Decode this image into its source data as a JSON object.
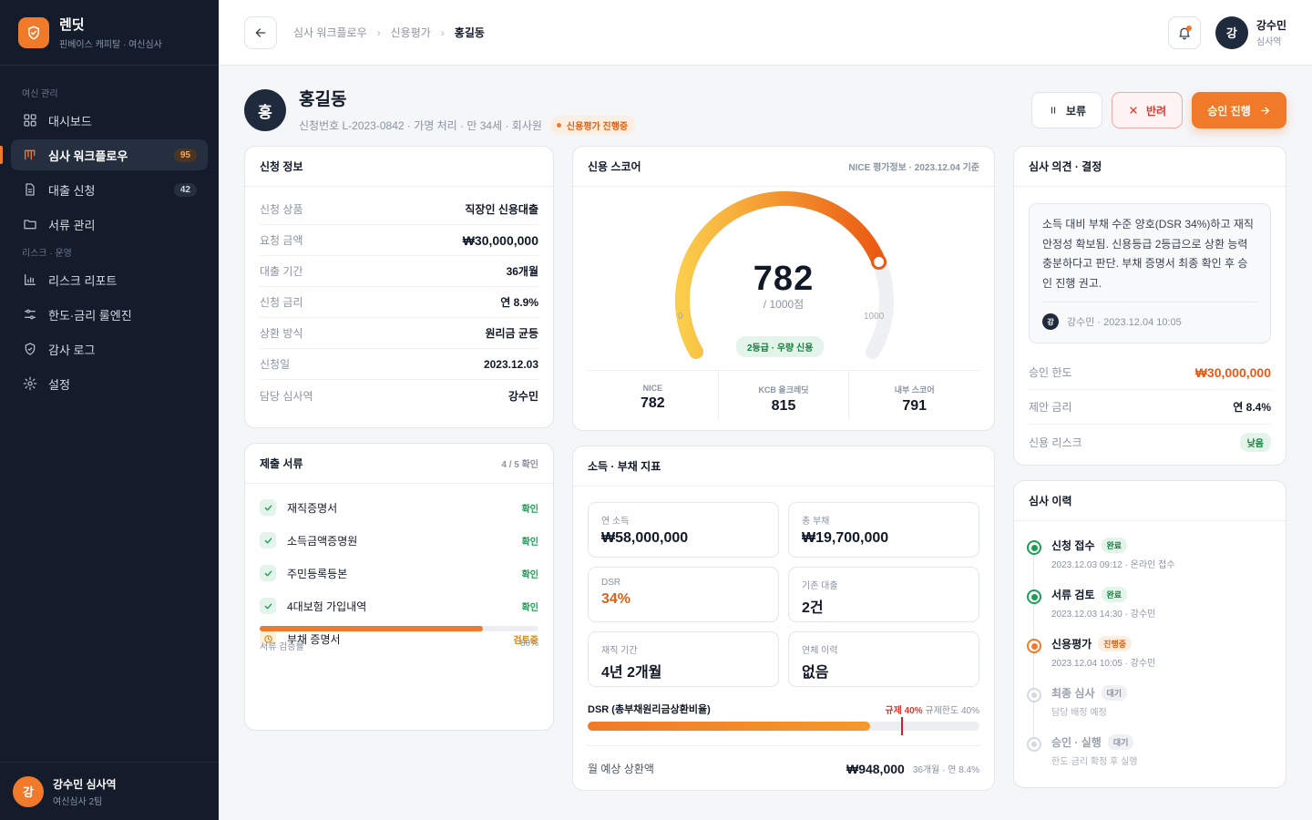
{
  "brand": {
    "name": "렌딧",
    "subtitle": "핀베이스 캐피탈 · 여신심사",
    "icon": "shield-check-icon"
  },
  "sidebar": {
    "section1": "여신 관리",
    "section2": "리스크 · 운영",
    "items": [
      {
        "label": "대시보드",
        "icon": "grid-icon"
      },
      {
        "label": "심사 워크플로우",
        "icon": "kanban-icon",
        "badge": "95",
        "active": true
      },
      {
        "label": "대출 신청",
        "icon": "document-icon",
        "badge": "42"
      },
      {
        "label": "서류 관리",
        "icon": "folder-icon"
      },
      {
        "label": "리스크 리포트",
        "icon": "bar-chart-icon"
      },
      {
        "label": "한도·금리 룰엔진",
        "icon": "sliders-icon"
      },
      {
        "label": "감사 로그",
        "icon": "shield-check-icon"
      },
      {
        "label": "설정",
        "icon": "gear-icon"
      }
    ],
    "user": {
      "initial": "강",
      "name": "강수민 심사역",
      "team": "여신심사 2팀"
    }
  },
  "topbar": {
    "breadcrumb": [
      "심사 워크플로우",
      "신용평가",
      "홍길동"
    ],
    "user": {
      "initial": "강",
      "name": "강수민",
      "role": "심사역"
    }
  },
  "applicant": {
    "initial": "홍",
    "name": "홍길동",
    "meta": "신청번호 L-2023-0842 · 가명 처리 · 만 34세 · 회사원",
    "status": "신용평가 진행중"
  },
  "actions": {
    "hold": "보류",
    "reject": "반려",
    "approve": "승인 진행"
  },
  "application_info": {
    "title": "신청 정보",
    "rows": [
      {
        "k": "신청 상품",
        "v": "직장인 신용대출"
      },
      {
        "k": "요청 금액",
        "v": "₩30,000,000"
      },
      {
        "k": "대출 기간",
        "v": "36개월"
      },
      {
        "k": "신청 금리",
        "v": "연 8.9%"
      },
      {
        "k": "상환 방식",
        "v": "원리금 균등"
      },
      {
        "k": "신청일",
        "v": "2023.12.03"
      },
      {
        "k": "담당 심사역",
        "v": "강수민"
      }
    ]
  },
  "documents": {
    "title": "제출 서류",
    "count": "4 / 5 확인",
    "items": [
      {
        "name": "재직증명서",
        "status": "확인",
        "done": true
      },
      {
        "name": "소득금액증명원",
        "status": "확인",
        "done": true
      },
      {
        "name": "주민등록등본",
        "status": "확인",
        "done": true
      },
      {
        "name": "4대보험 가입내역",
        "status": "확인",
        "done": true
      },
      {
        "name": "부채 증명서",
        "status": "검토중",
        "done": false
      }
    ],
    "progress_label": "서류 검증률",
    "progress_text": "80%",
    "progress": 0.8
  },
  "credit_score": {
    "title": "신용 스코어",
    "source": "NICE 평가정보 · 2023.12.04 기준",
    "score": "782",
    "max_label": "/ 1000점",
    "score_fraction": 0.782,
    "min_tick": "0",
    "max_tick": "1000",
    "grade": "2등급 · 우량 신용",
    "bureaus": [
      {
        "label": "NICE",
        "value": "782"
      },
      {
        "label": "KCB 올크레딧",
        "value": "815"
      },
      {
        "label": "내부 스코어",
        "value": "791"
      }
    ],
    "colors": {
      "start": "#fbcd4b",
      "end": "#ea5a12",
      "track": "#eef0f3"
    }
  },
  "income_debt": {
    "title": "소득 · 부채 지표",
    "metrics": [
      {
        "label": "연 소득",
        "value": "₩58,000,000"
      },
      {
        "label": "총 부채",
        "value": "₩19,700,000"
      },
      {
        "label": "DSR",
        "value": "34%"
      },
      {
        "label": "기존 대출",
        "value": "2건"
      },
      {
        "label": "재직 기간",
        "value": "4년 2개월"
      },
      {
        "label": "연체 이력",
        "value": "없음"
      }
    ],
    "dsr_label": "DSR (총부채원리금상환비율)",
    "dsr_limit_label": "규제 40%",
    "dsr_limit_text": "규제한도 40%",
    "dsr_fill": 0.72,
    "dsr_limit_fraction": 0.8,
    "repay_label": "월 예상 상환액",
    "repay_value": "₩948,000",
    "repay_sub": "36개월 · 연 8.4%"
  },
  "decision": {
    "title": "심사 의견 · 결정",
    "opinion": "소득 대비 부채 수준 양호(DSR 34%)하고 재직 안정성 확보됨. 신용등급 2등급으로 상환 능력 충분하다고 판단. 부채 증명서 최종 확인 후 승인 진행 권고.",
    "author_initial": "강",
    "author": "강수민 · 2023.12.04 10:05",
    "rows": [
      {
        "k": "승인 한도",
        "v": "₩30,000,000"
      },
      {
        "k": "제안 금리",
        "v": "연 8.4%"
      },
      {
        "k": "신용 리스크",
        "v": "낮음"
      }
    ]
  },
  "history": {
    "title": "심사 이력",
    "items": [
      {
        "title": "신청 접수",
        "tag": "완료",
        "state": "done",
        "meta": "2023.12.03 09:12 · 온라인 접수"
      },
      {
        "title": "서류 검토",
        "tag": "완료",
        "state": "done",
        "meta": "2023.12.03 14:30 · 강수민"
      },
      {
        "title": "신용평가",
        "tag": "진행중",
        "state": "cur",
        "meta": "2023.12.04 10:05 · 강수민"
      },
      {
        "title": "최종 심사",
        "tag": "대기",
        "state": "wait",
        "meta": "담당 배정 예정"
      },
      {
        "title": "승인 · 실행",
        "tag": "대기",
        "state": "wait",
        "meta": "한도·금리 확정 후 실행"
      }
    ]
  },
  "accent": "#f07a2a"
}
